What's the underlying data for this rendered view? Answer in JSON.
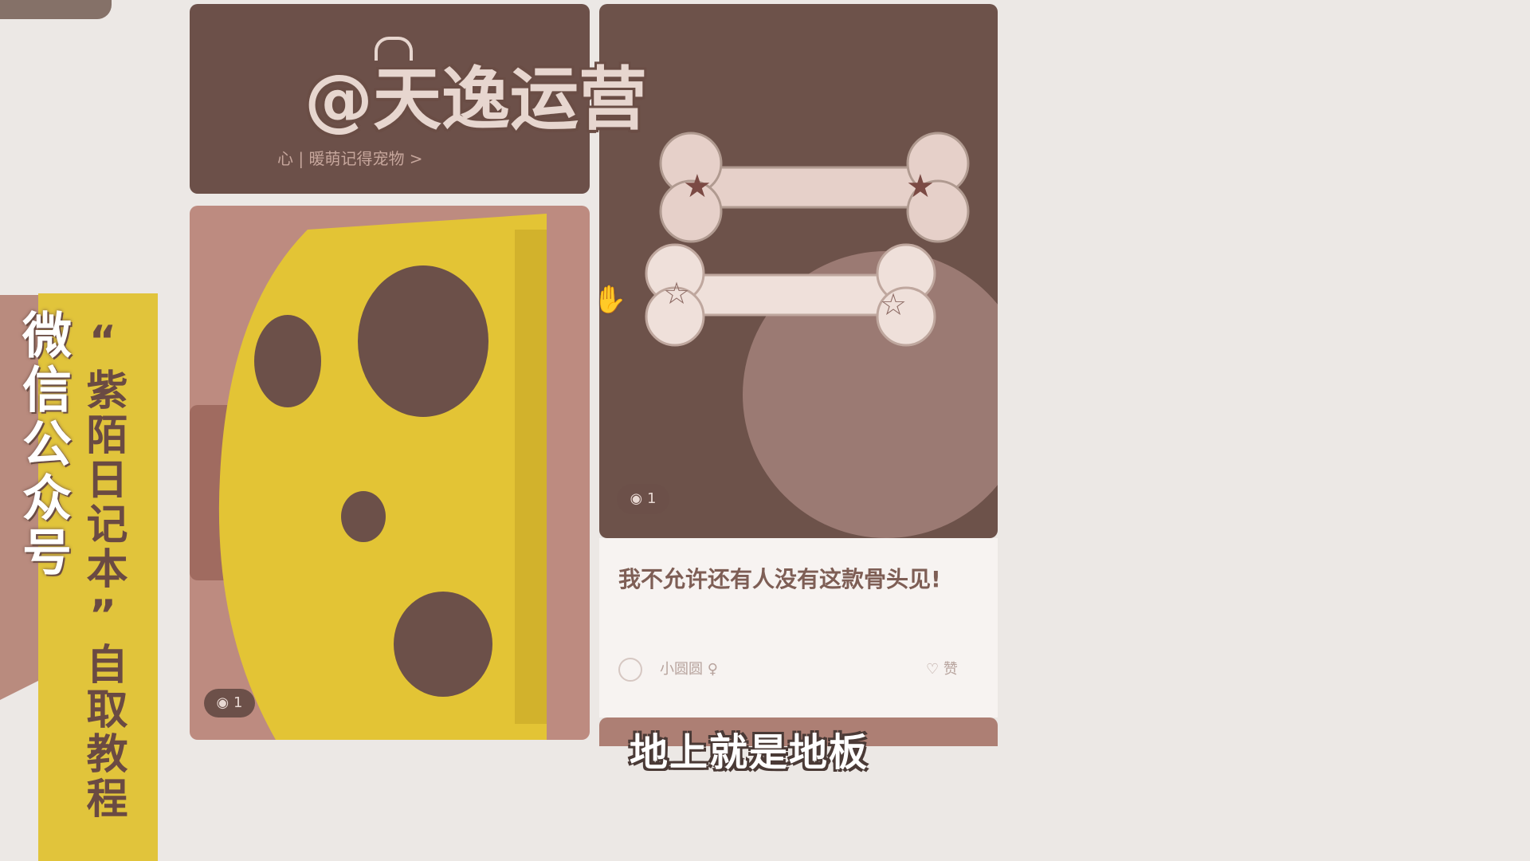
{
  "watermark": {
    "text": "@天逸运营"
  },
  "side_banner": {
    "wechat": "微信公众号",
    "promo": "“紫陌日记本”自取教程"
  },
  "feed": {
    "top_left_subtitle": "心 | 暖萌记得宠物 >",
    "left_views": "◉ 1",
    "right_views": "◉ 1",
    "post_title": "我不允许还有人没有这款骨头见!",
    "author": "小圆圆 ♀",
    "likes": "♡ 赞"
  },
  "subtitle": {
    "text": "地上就是地板"
  },
  "colors": {
    "yellow": "#e1c43b",
    "brown": "#6c5049",
    "pink": "#b98b7e"
  }
}
